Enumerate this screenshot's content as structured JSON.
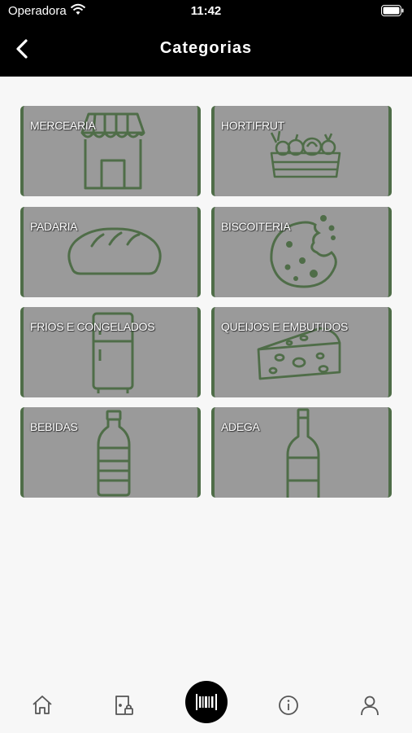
{
  "status_bar": {
    "carrier": "Operadora",
    "time": "11:42"
  },
  "header": {
    "title": "Categorias",
    "back_icon": "chevron-left-icon"
  },
  "categories": [
    {
      "label": "MERCEARIA",
      "icon": "storefront-icon"
    },
    {
      "label": "HORTIFRUT",
      "icon": "vegetable-crate-icon"
    },
    {
      "label": "PADARIA",
      "icon": "bread-icon"
    },
    {
      "label": "BISCOITERIA",
      "icon": "cookie-icon"
    },
    {
      "label": "FRIOS E CONGELADOS",
      "icon": "refrigerator-icon"
    },
    {
      "label": "QUEIJOS E EMBUTIDOS",
      "icon": "cheese-icon"
    },
    {
      "label": "BEBIDAS",
      "icon": "bottle-icon"
    },
    {
      "label": "ADEGA",
      "icon": "wine-bottle-icon"
    }
  ],
  "tab_bar": {
    "items": [
      "home-icon",
      "locked-door-icon",
      "barcode-scanner-icon",
      "info-icon",
      "user-icon"
    ]
  },
  "colors": {
    "header_bg": "#000000",
    "card_bg": "#9a9a9a",
    "accent_green": "#4f6d48",
    "tab_icon": "#555555"
  }
}
